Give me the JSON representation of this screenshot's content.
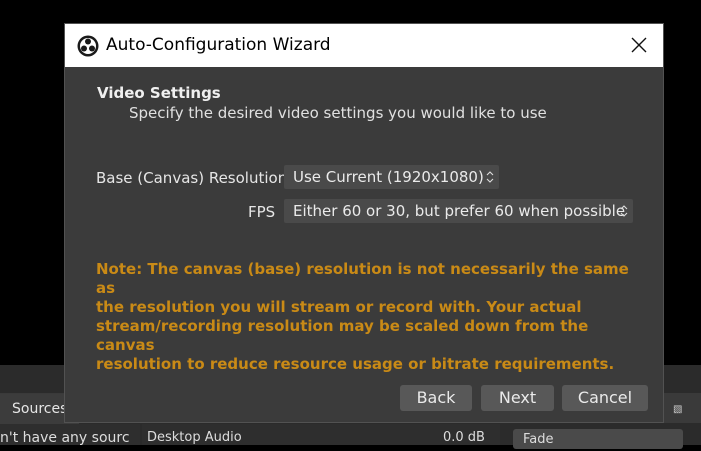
{
  "background": {
    "sources_tab_label": "Sources",
    "sources_hint": "n't have any sourc",
    "audio_device_name": "Desktop Audio",
    "audio_device_level": "0.0 dB",
    "transition_value": "Fade"
  },
  "dialog": {
    "title": "Auto-Configuration Wizard",
    "section_title": "Video Settings",
    "section_subtitle": "Specify the desired video settings you would like to use",
    "base_resolution_label": "Base (Canvas) Resolution",
    "base_resolution_value": "Use Current (1920x1080)",
    "fps_label": "FPS",
    "fps_value": "Either 60 or 30, but prefer 60 when possible",
    "note_line1": "Note: The canvas (base) resolution is not necessarily the same as",
    "note_line2": "the resolution you will stream or record with. Your actual",
    "note_line3": "stream/recording resolution may be scaled down from the canvas",
    "note_line4": "resolution to reduce resource usage or bitrate requirements.",
    "back_label": "Back",
    "next_label": "Next",
    "cancel_label": "Cancel",
    "note_color": "#c98a16"
  },
  "icons": [
    "obs-logo-icon",
    "close-icon",
    "chevron-updown-icon"
  ]
}
